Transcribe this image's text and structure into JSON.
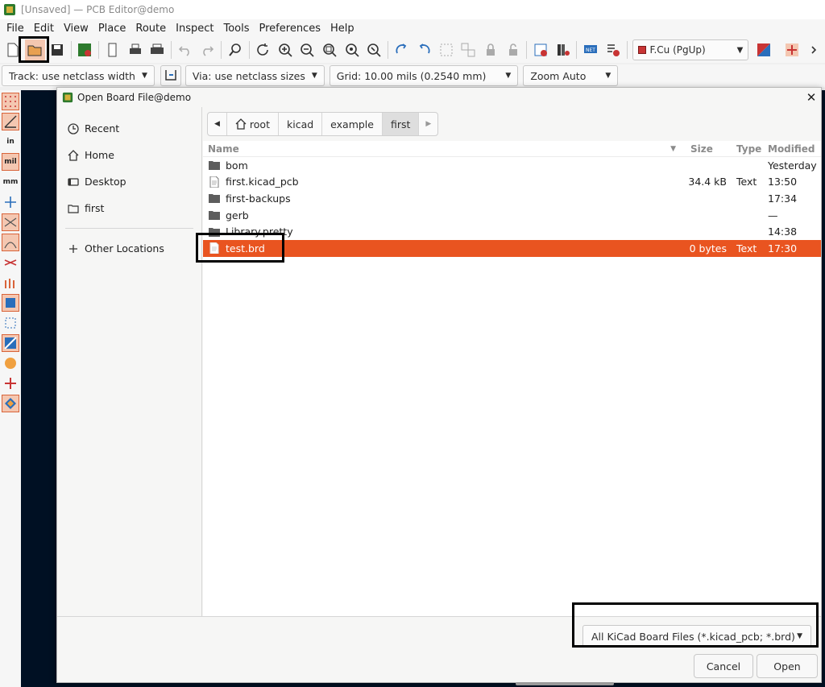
{
  "window": {
    "title": "[Unsaved] — PCB Editor@demo"
  },
  "menubar": [
    "File",
    "Edit",
    "View",
    "Place",
    "Route",
    "Inspect",
    "Tools",
    "Preferences",
    "Help"
  ],
  "toolbar": {
    "layer_selected": "F.Cu (PgUp)"
  },
  "toolbar2": {
    "track": "Track: use netclass width",
    "via": "Via: use netclass sizes",
    "grid": "Grid: 10.00 mils (0.2540 mm)",
    "zoom": "Zoom Auto"
  },
  "left_tools": {
    "unit_in": "in",
    "unit_mil": "mil",
    "unit_mm": "mm"
  },
  "dialog": {
    "title": "Open Board File@demo",
    "places": [
      {
        "label": "Recent",
        "icon": "clock-icon"
      },
      {
        "label": "Home",
        "icon": "home-icon"
      },
      {
        "label": "Desktop",
        "icon": "desktop-icon"
      },
      {
        "label": "first",
        "icon": "folder-icon"
      }
    ],
    "other_locations": "Other Locations",
    "breadcrumb": [
      "root",
      "kicad",
      "example",
      "first"
    ],
    "columns": {
      "name": "Name",
      "size": "Size",
      "type": "Type",
      "modified": "Modified"
    },
    "files": [
      {
        "name": "bom",
        "kind": "folder",
        "size": "",
        "type": "",
        "modified": "Yesterday"
      },
      {
        "name": "first.kicad_pcb",
        "kind": "file",
        "size": "34.4 kB",
        "type": "Text",
        "modified": "13:50"
      },
      {
        "name": "first-backups",
        "kind": "folder",
        "size": "",
        "type": "",
        "modified": "17:34"
      },
      {
        "name": "gerb",
        "kind": "folder",
        "size": "",
        "type": "",
        "modified": "—"
      },
      {
        "name": "Library.pretty",
        "kind": "folder",
        "size": "",
        "type": "",
        "modified": "14:38"
      },
      {
        "name": "test.brd",
        "kind": "file",
        "size": "0 bytes",
        "type": "Text",
        "modified": "17:30",
        "selected": true
      }
    ],
    "filter": "All KiCad Board Files (*.kicad_pcb; *.brd)",
    "cancel_label": "Cancel",
    "open_label": "Open"
  },
  "colors": {
    "selection": "#e95420",
    "canvas": "#001023",
    "highlight_box": "#000000"
  }
}
